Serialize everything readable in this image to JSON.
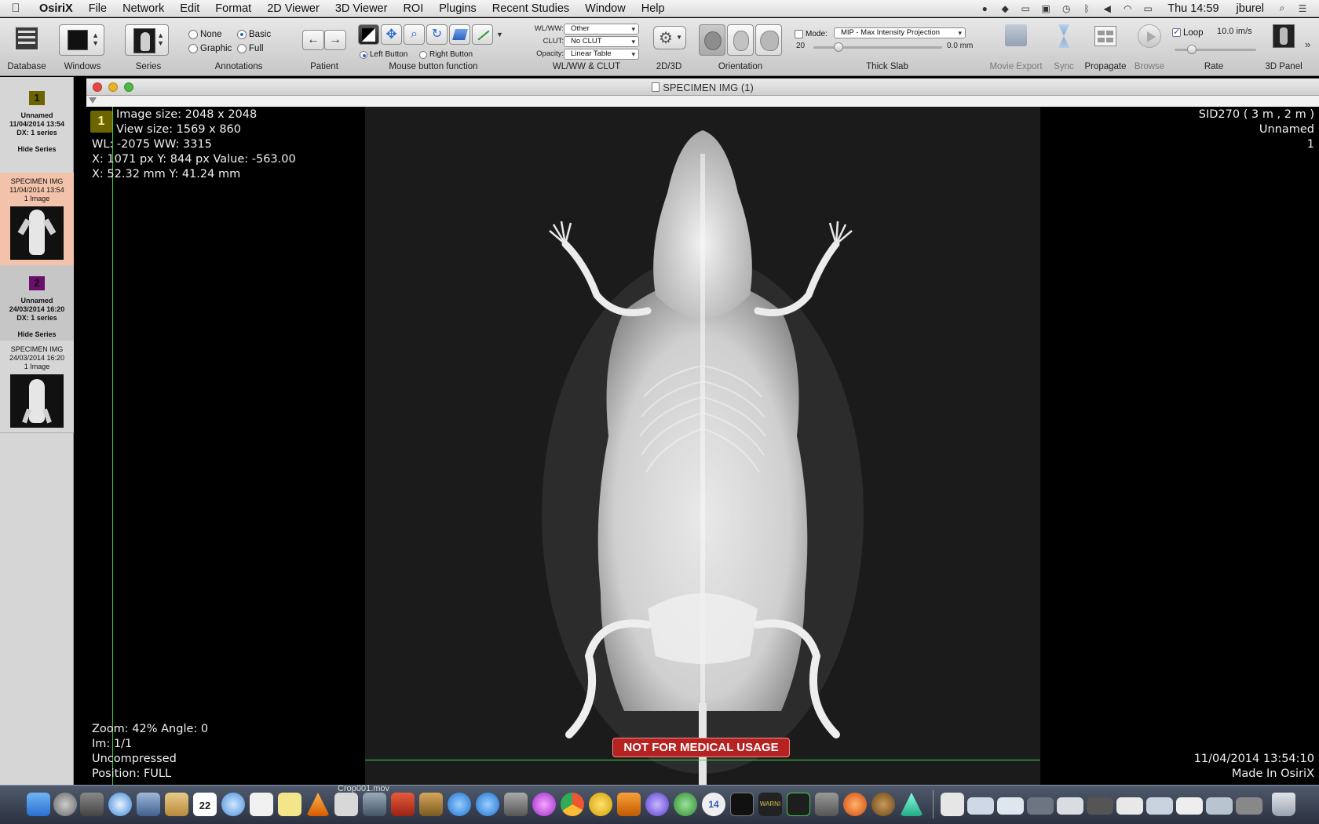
{
  "menubar": {
    "app": "OsiriX",
    "items": [
      "File",
      "Network",
      "Edit",
      "Format",
      "2D Viewer",
      "3D Viewer",
      "ROI",
      "Plugins",
      "Recent Studies",
      "Window",
      "Help"
    ],
    "clock": "Thu 14:59",
    "user": "jburel"
  },
  "toolbar": {
    "database": "Database",
    "windows": "Windows",
    "series": "Series",
    "annotations": "Annotations",
    "annotation_options": [
      "None",
      "Basic",
      "Graphic",
      "Full"
    ],
    "annotation_selected": "Basic",
    "patient": "Patient",
    "mouse_button_function": "Mouse button function",
    "left_button": "Left Button",
    "right_button": "Right Button",
    "wl_ww_label": "WL/WW:",
    "wl_ww_value": "Other",
    "clut_label": "CLUT:",
    "clut_value": "No CLUT",
    "opacity_label": "Opacity:",
    "opacity_value": "Linear Table",
    "wl_ww_clut": "WL/WW & CLUT",
    "d2d3": "2D/3D",
    "orientation": "Orientation",
    "mode_label": "Mode:",
    "mode_value": "MIP - Max Intensity Projection",
    "slab_count": "20",
    "slab_mm": "0.0 mm",
    "thick_slab": "Thick Slab",
    "movie_export": "Movie Export",
    "sync": "Sync",
    "propagate": "Propagate",
    "browse": "Browse",
    "loop": "Loop",
    "rate_value": "10.0 im/s",
    "rate": "Rate",
    "panel3d": "3D Panel"
  },
  "sidebar": {
    "studies": [
      {
        "num": "1",
        "color": "#6b6400",
        "name": "Unnamed",
        "date": "11/04/2014 13:54",
        "info": "DX: 1 series",
        "hide": "Hide Series",
        "series_name": "SPECIMEN IMG",
        "series_date": "11/04/2014 13:54",
        "series_count": "1 Image"
      },
      {
        "num": "2",
        "color": "#6b0f6b",
        "name": "Unnamed",
        "date": "24/03/2014 16:20",
        "info": "DX: 1 series",
        "hide": "Hide Series",
        "series_name": "SPECIMEN IMG",
        "series_date": "24/03/2014 16:20",
        "series_count": "1 Image"
      }
    ]
  },
  "window": {
    "title": "SPECIMEN IMG (1)"
  },
  "viewer": {
    "badge": "1",
    "top_left": [
      "Image size: 2048 x 2048",
      "View size: 1569 x 860",
      "WL: -2075 WW: 3315",
      "X: 1071 px Y: 844 px Value: -563.00",
      "X: 52.32 mm Y: 41.24 mm"
    ],
    "top_right": [
      "SID270 ( 3 m , 2 m )",
      "Unnamed",
      "1"
    ],
    "bottom_left": [
      "Zoom: 42% Angle: 0",
      "Im: 1/1",
      "Uncompressed",
      "Position: FULL"
    ],
    "bottom_right": [
      "11/04/2014 13:54:10",
      "Made In OsiriX"
    ],
    "warning": "NOT FOR MEDICAL USAGE"
  },
  "dock": {
    "hover_label": "Crop001.mov",
    "calendar_day": "22",
    "clock_badge": "14",
    "console_text": "WARNI"
  }
}
